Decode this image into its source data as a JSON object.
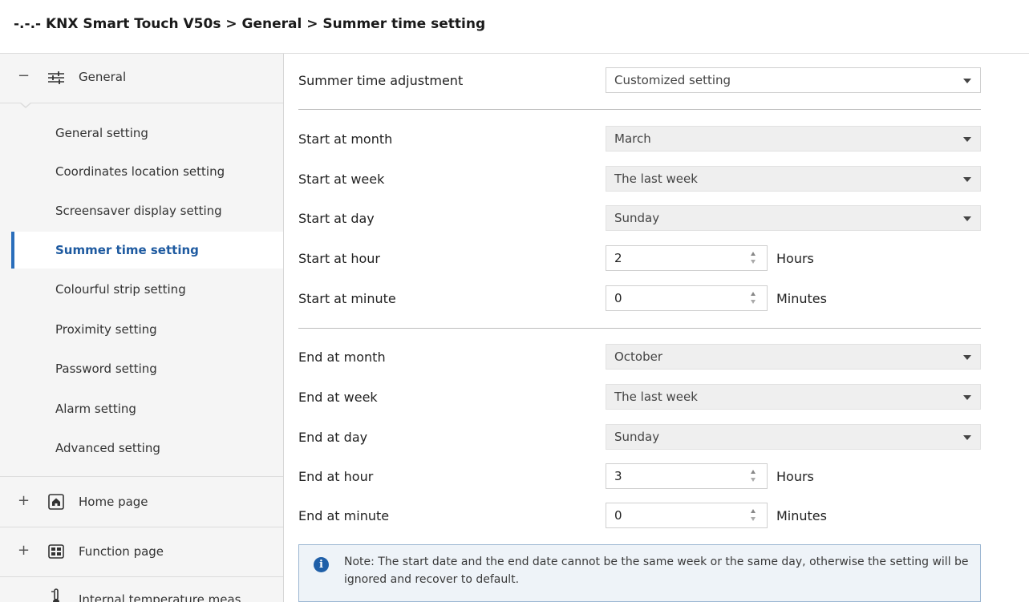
{
  "header": {
    "title": "-.-.- KNX Smart Touch V50s > General > Summer time setting"
  },
  "sidebar": {
    "general_group": {
      "toggle": "−",
      "label": "General",
      "icon": "sliders-icon"
    },
    "items": [
      {
        "label": "General setting",
        "active": false
      },
      {
        "label": "Coordinates location setting",
        "active": false
      },
      {
        "label": "Screensaver display setting",
        "active": false
      },
      {
        "label": "Summer time setting",
        "active": true
      },
      {
        "label": "Colourful strip setting",
        "active": false
      },
      {
        "label": "Proximity setting",
        "active": false
      },
      {
        "label": "Password setting",
        "active": false
      },
      {
        "label": "Alarm setting",
        "active": false
      },
      {
        "label": "Advanced setting",
        "active": false
      }
    ],
    "home_group": {
      "toggle": "+",
      "label": "Home page",
      "icon": "home-icon"
    },
    "function_group": {
      "toggle": "+",
      "label": "Function page",
      "icon": "grid-icon"
    },
    "temp_group": {
      "label": "Internal temperature meas",
      "icon": "thermometer-icon"
    }
  },
  "form": {
    "summer_adjust": {
      "label": "Summer time adjustment",
      "value": "Customized setting"
    },
    "start_month": {
      "label": "Start at month",
      "value": "March"
    },
    "start_week": {
      "label": "Start at week",
      "value": "The last week"
    },
    "start_day": {
      "label": "Start at day",
      "value": "Sunday"
    },
    "start_hour": {
      "label": "Start at hour",
      "value": "2",
      "unit": "Hours"
    },
    "start_minute": {
      "label": "Start at minute",
      "value": "0",
      "unit": "Minutes"
    },
    "end_month": {
      "label": "End at month",
      "value": "October"
    },
    "end_week": {
      "label": "End at week",
      "value": "The last week"
    },
    "end_day": {
      "label": "End at day",
      "value": "Sunday"
    },
    "end_hour": {
      "label": "End at hour",
      "value": "3",
      "unit": "Hours"
    },
    "end_minute": {
      "label": "End at minute",
      "value": "0",
      "unit": "Minutes"
    }
  },
  "note": {
    "icon": "info-icon",
    "text": "Note: The start date and the end date cannot be the same week or the same day, otherwise the setting will be ignored and recover to default."
  }
}
